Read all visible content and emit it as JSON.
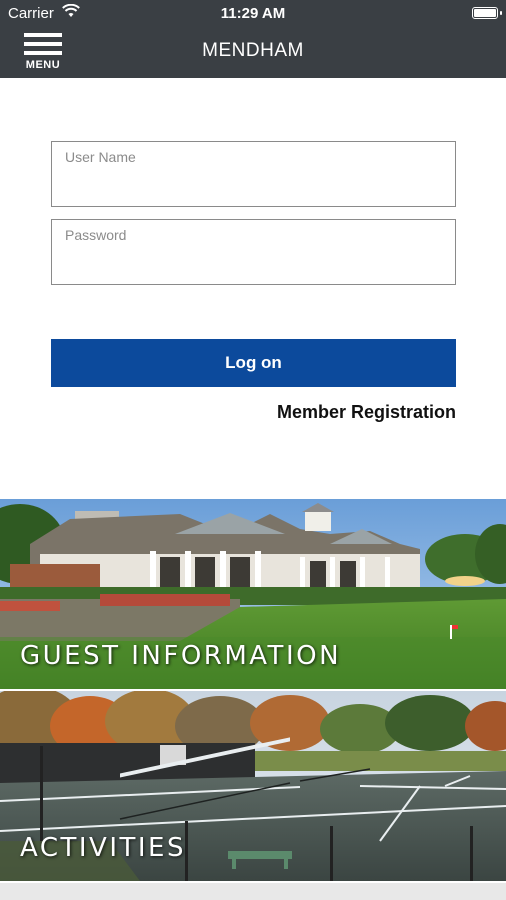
{
  "status_bar": {
    "carrier": "Carrier",
    "time": "11:29 AM"
  },
  "nav": {
    "menu_label": "MENU",
    "title": "MENDHAM"
  },
  "login": {
    "username_placeholder": "User Name",
    "password_placeholder": "Password",
    "logon_label": "Log on",
    "register_label": "Member Registration"
  },
  "tiles": [
    {
      "label": "GUEST INFORMATION"
    },
    {
      "label": "ACTIVITIES"
    }
  ],
  "colors": {
    "nav_bg": "#3a3f44",
    "logon_bg": "#0c4a9c"
  }
}
